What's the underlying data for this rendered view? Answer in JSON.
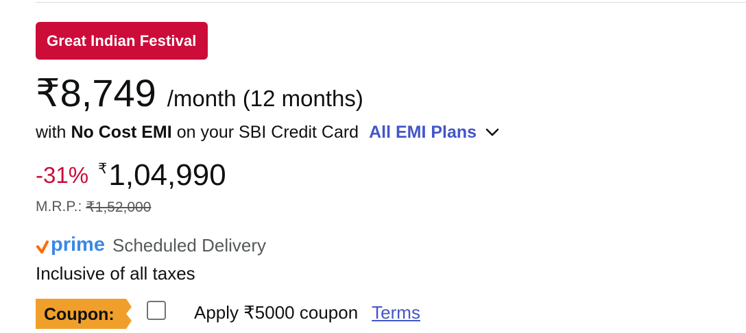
{
  "deal_badge": {
    "label": "Great Indian Festival",
    "color": "#cc0c39"
  },
  "emi": {
    "price": "₹8,749",
    "period": "/month (12 months)",
    "prefix": "with",
    "highlight": "No Cost EMI",
    "suffix": "on your SBI Credit Card",
    "link_label": "All EMI Plans",
    "link_icon": "chevron-down-icon"
  },
  "price": {
    "discount": "-31%",
    "currency_symbol": "₹",
    "value": "1,04,990"
  },
  "mrp": {
    "label": "M.R.P.:",
    "value": "₹1,52,000"
  },
  "delivery": {
    "prime_logo": "prime",
    "text": "Scheduled Delivery"
  },
  "tax_note": "Inclusive of all taxes",
  "coupon": {
    "tag_label": "Coupon:",
    "tag_color": "#f0a02a",
    "checked": false,
    "text": "Apply ₹5000 coupon",
    "terms_label": "Terms"
  },
  "colors": {
    "link": "#4355c9",
    "discount": "#cc0c39",
    "muted": "#565959",
    "prime_check": "#ff6a00",
    "prime_blue": "#3b88e6"
  }
}
